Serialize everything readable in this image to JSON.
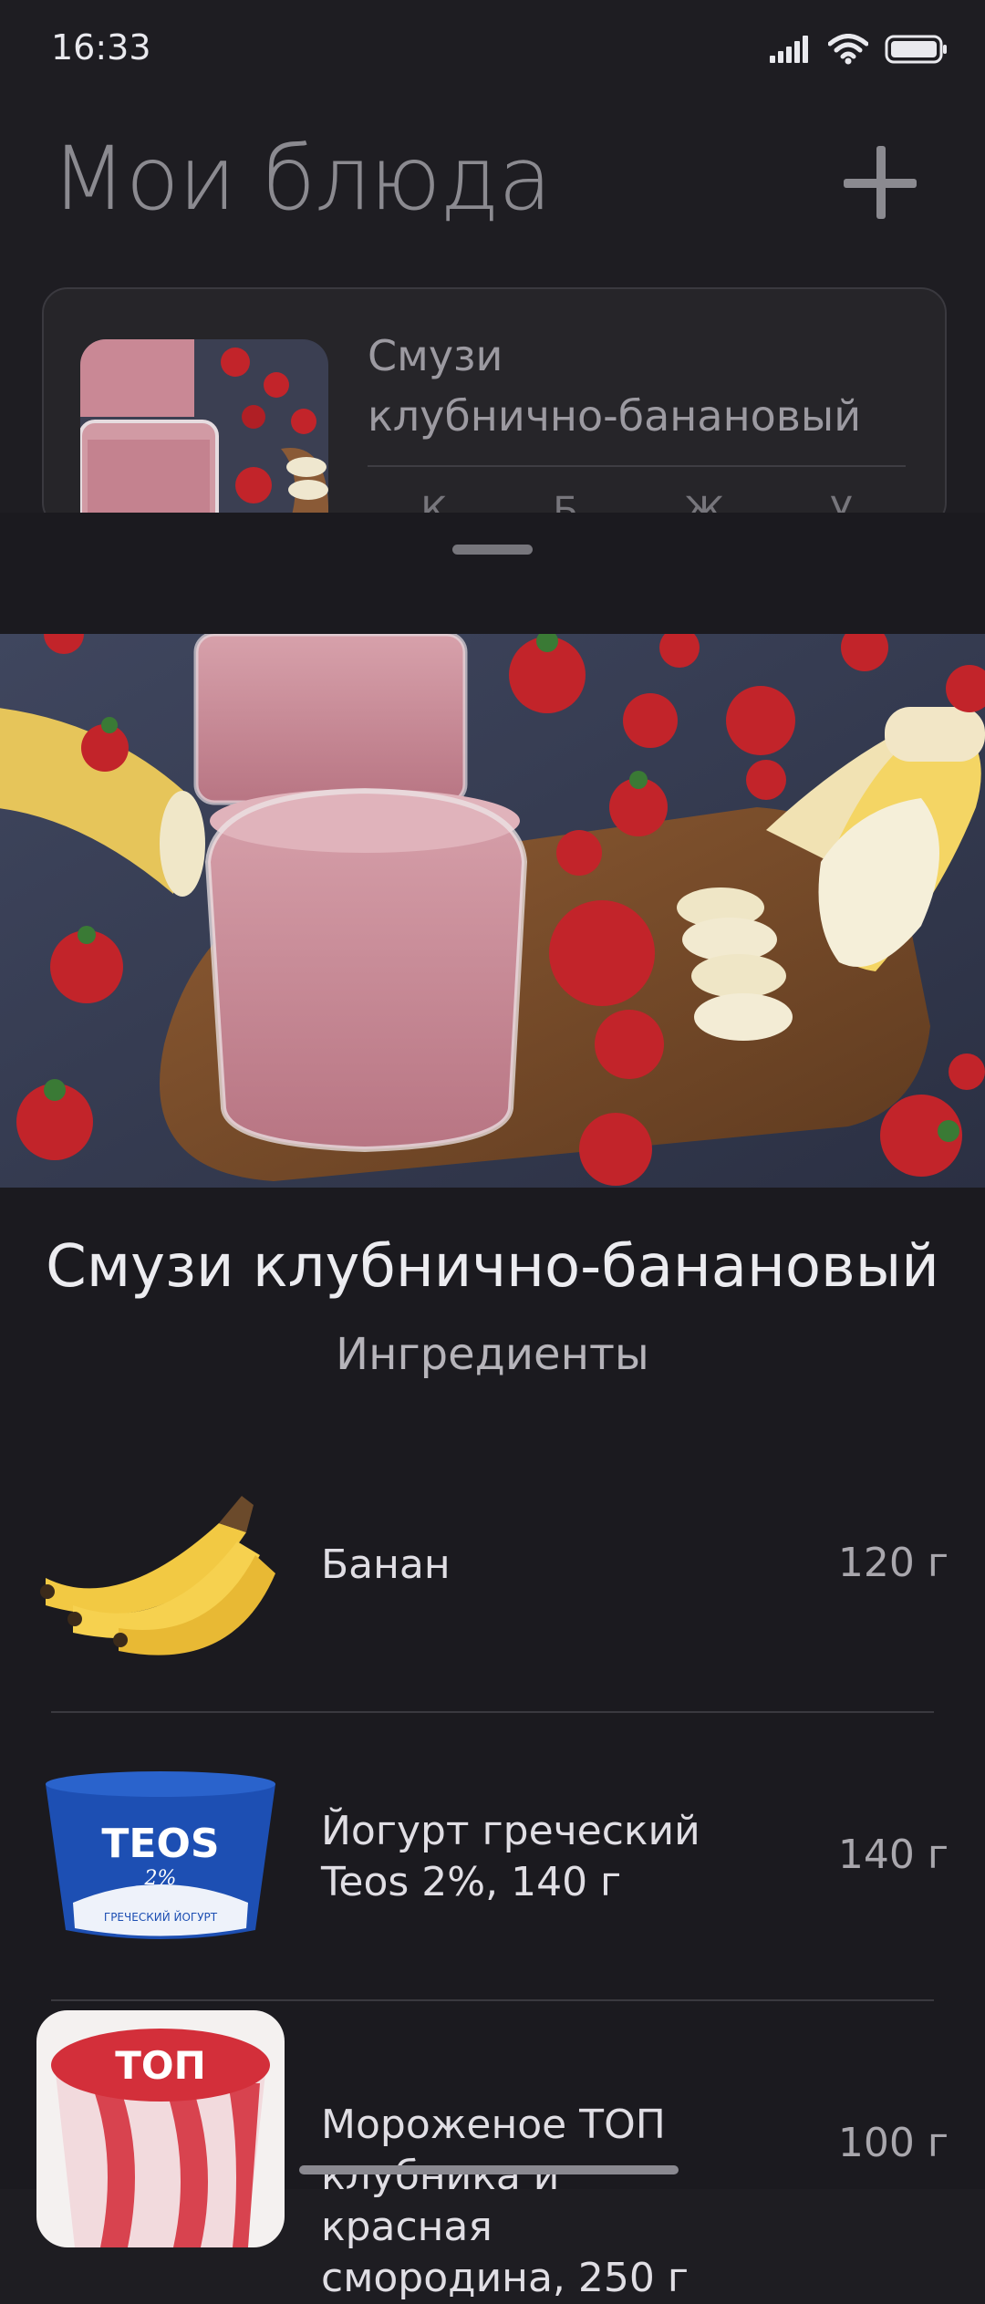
{
  "status_bar": {
    "time": "16:33",
    "icons": [
      "signal-icon",
      "wifi-icon",
      "battery-icon"
    ]
  },
  "background_page": {
    "title": "Мои блюда",
    "add_icon": "plus-icon",
    "card": {
      "name_line1": "Смузи",
      "name_line2": "клубнично-банановый",
      "macros": [
        "К",
        "Б",
        "Ж",
        "У"
      ]
    }
  },
  "sheet": {
    "dish_title": "Смузи клубнично-банановый",
    "ingredients_title": "Ингредиенты",
    "ingredients": [
      {
        "name_line1": "Банан",
        "name_line2": "",
        "name_line3": "",
        "qty": "120 г",
        "image": "banana"
      },
      {
        "name_line1": "Йогурт греческий",
        "name_line2": "Teos 2%, 140 г",
        "name_line3": "",
        "qty": "140 г",
        "image": "yogurt-cup",
        "brand": "TEOS",
        "brand_pct": "2%",
        "brand_caption": "ГРЕЧЕСКИЙ ЙОГУРТ"
      },
      {
        "name_line1": "Мороженое ТОП",
        "name_line2": "клубника и красная",
        "name_line3": "смородина, 250 г",
        "qty": "100 г",
        "image": "ice-cream-cup",
        "brand": "ТОП"
      }
    ]
  },
  "colors": {
    "background": "#1e1d22",
    "sheet": "#1b1a1f",
    "smoothie": "#c98895",
    "strawberry": "#c2242a",
    "banana": "#f2c943",
    "teos_blue": "#1d4fb3"
  }
}
